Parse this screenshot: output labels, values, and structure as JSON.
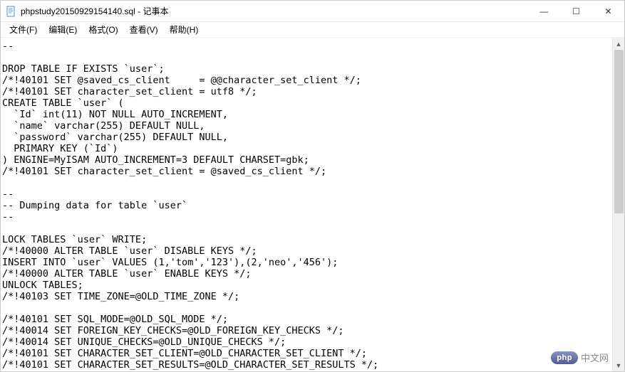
{
  "window": {
    "title": "phpstudy20150929154140.sql - 记事本"
  },
  "menu": {
    "file": "文件(F)",
    "edit": "编辑(E)",
    "format": "格式(O)",
    "view": "查看(V)",
    "help": "帮助(H)"
  },
  "controls": {
    "minimize": "—",
    "maximize": "☐",
    "close": "✕"
  },
  "scrollbar": {
    "up": "▲",
    "down": "▼"
  },
  "content": {
    "text": "--\n\nDROP TABLE IF EXISTS `user`;\n/*!40101 SET @saved_cs_client     = @@character_set_client */;\n/*!40101 SET character_set_client = utf8 */;\nCREATE TABLE `user` (\n  `Id` int(11) NOT NULL AUTO_INCREMENT,\n  `name` varchar(255) DEFAULT NULL,\n  `password` varchar(255) DEFAULT NULL,\n  PRIMARY KEY (`Id`)\n) ENGINE=MyISAM AUTO_INCREMENT=3 DEFAULT CHARSET=gbk;\n/*!40101 SET character_set_client = @saved_cs_client */;\n\n--\n-- Dumping data for table `user`\n--\n\nLOCK TABLES `user` WRITE;\n/*!40000 ALTER TABLE `user` DISABLE KEYS */;\nINSERT INTO `user` VALUES (1,'tom','123'),(2,'neo','456');\n/*!40000 ALTER TABLE `user` ENABLE KEYS */;\nUNLOCK TABLES;\n/*!40103 SET TIME_ZONE=@OLD_TIME_ZONE */;\n\n/*!40101 SET SQL_MODE=@OLD_SQL_MODE */;\n/*!40014 SET FOREIGN_KEY_CHECKS=@OLD_FOREIGN_KEY_CHECKS */;\n/*!40014 SET UNIQUE_CHECKS=@OLD_UNIQUE_CHECKS */;\n/*!40101 SET CHARACTER_SET_CLIENT=@OLD_CHARACTER_SET_CLIENT */;\n/*!40101 SET CHARACTER_SET_RESULTS=@OLD_CHARACTER_SET_RESULTS */;"
  },
  "watermark": {
    "logo": "php",
    "text": "中文网"
  }
}
